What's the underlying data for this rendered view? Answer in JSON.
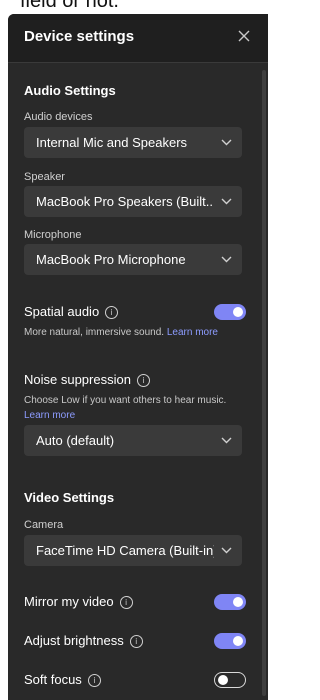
{
  "background_text": "field or not.",
  "dialog": {
    "title": "Device settings",
    "close_icon": "close-icon"
  },
  "audio": {
    "section_title": "Audio Settings",
    "devices": {
      "label": "Audio devices",
      "value": "Internal Mic and Speakers"
    },
    "speaker": {
      "label": "Speaker",
      "value": "MacBook Pro Speakers (Built..."
    },
    "microphone": {
      "label": "Microphone",
      "value": "MacBook Pro Microphone"
    },
    "spatial": {
      "label": "Spatial audio",
      "description": "More natural, immersive sound.",
      "link": "Learn more",
      "enabled": true
    },
    "noise": {
      "label": "Noise suppression",
      "description": "Choose Low if you want others to hear music.",
      "link": "Learn more",
      "value": "Auto (default)"
    }
  },
  "video": {
    "section_title": "Video Settings",
    "camera": {
      "label": "Camera",
      "value": "FaceTime HD Camera (Built-in)"
    },
    "mirror": {
      "label": "Mirror my video",
      "enabled": true
    },
    "brightness": {
      "label": "Adjust brightness",
      "enabled": true
    },
    "soft_focus": {
      "label": "Soft focus",
      "enabled": false
    }
  },
  "colors": {
    "panel": "#292929",
    "header": "#1f1f1f",
    "accent": "#7f85f5",
    "link": "#8d9cff"
  }
}
